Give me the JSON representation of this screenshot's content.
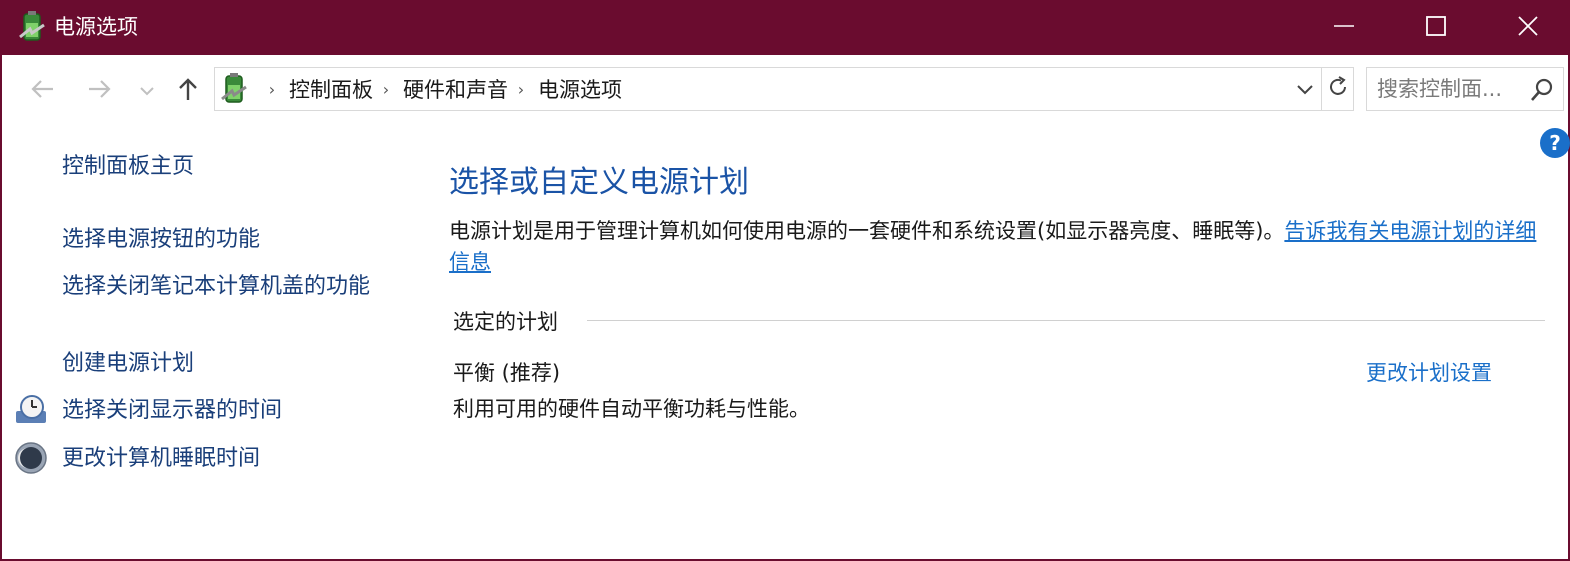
{
  "window": {
    "title": "电源选项",
    "icon": "power-options-battery-icon",
    "title_bar_color": "#6a0c2f"
  },
  "nav": {
    "back_icon": "back-arrow-icon",
    "forward_icon": "forward-arrow-icon",
    "recent_icon": "chevron-down-icon",
    "up_icon": "up-arrow-icon"
  },
  "address": {
    "breadcrumbs": [
      "控制面板",
      "硬件和声音",
      "电源选项"
    ],
    "separator": "›"
  },
  "search": {
    "placeholder": "搜索控制面..."
  },
  "help": {
    "label": "?"
  },
  "sidebar": {
    "home": "控制面板主页",
    "items": [
      {
        "label": "选择电源按钮的功能",
        "icon": ""
      },
      {
        "label": "选择关闭笔记本计算机盖的功能",
        "icon": ""
      },
      {
        "label": "创建电源计划",
        "icon": ""
      },
      {
        "label": "选择关闭显示器的时间",
        "icon": "display-timer-icon"
      },
      {
        "label": "更改计算机睡眠时间",
        "icon": "sleep-moon-icon"
      }
    ]
  },
  "main": {
    "heading": "选择或自定义电源计划",
    "description": "电源计划是用于管理计算机如何使用电源的一套硬件和系统设置(如显示器亮度、睡眠等)。",
    "description_link": "告诉我有关电源计划的详细信息",
    "selected_section_label": "选定的计划",
    "plan": {
      "name": "平衡 (推荐)",
      "description": "利用可用的硬件自动平衡功耗与性能。",
      "change_link": "更改计划设置"
    }
  },
  "colors": {
    "accent_link": "#1a6fc9",
    "heading": "#1a53a6"
  }
}
